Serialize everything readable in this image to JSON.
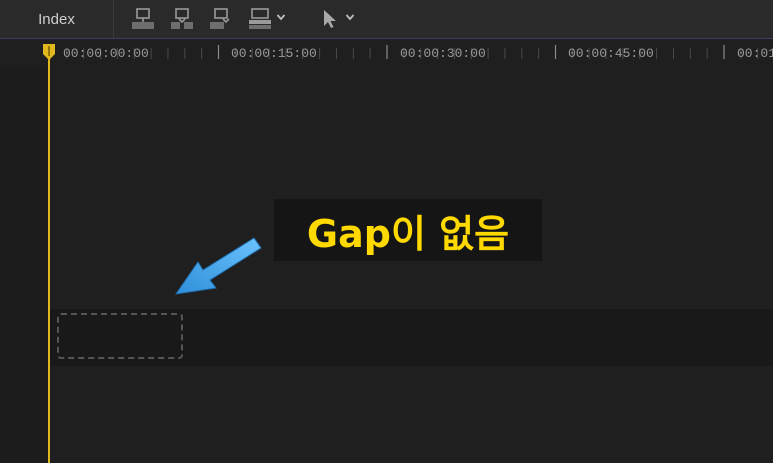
{
  "toolbar": {
    "index_label": "Index",
    "tools": [
      {
        "icon": "connect-clip-icon"
      },
      {
        "icon": "insert-clip-icon"
      },
      {
        "icon": "append-clip-icon"
      },
      {
        "icon": "overwrite-clip-icon"
      },
      {
        "icon": "select-tool-icon"
      }
    ]
  },
  "ruler": {
    "timecodes": [
      "00:00:00:00",
      "00:00:15:00",
      "00:00:30:00",
      "00:00:45:00",
      "00:01"
    ]
  },
  "annotation": {
    "text": "Gap이 없음"
  },
  "colors": {
    "playhead": "#e2b81f",
    "annotation_text": "#ffd900",
    "arrow": "#3aa0e8",
    "toolbar_border": "#3d3a66"
  }
}
